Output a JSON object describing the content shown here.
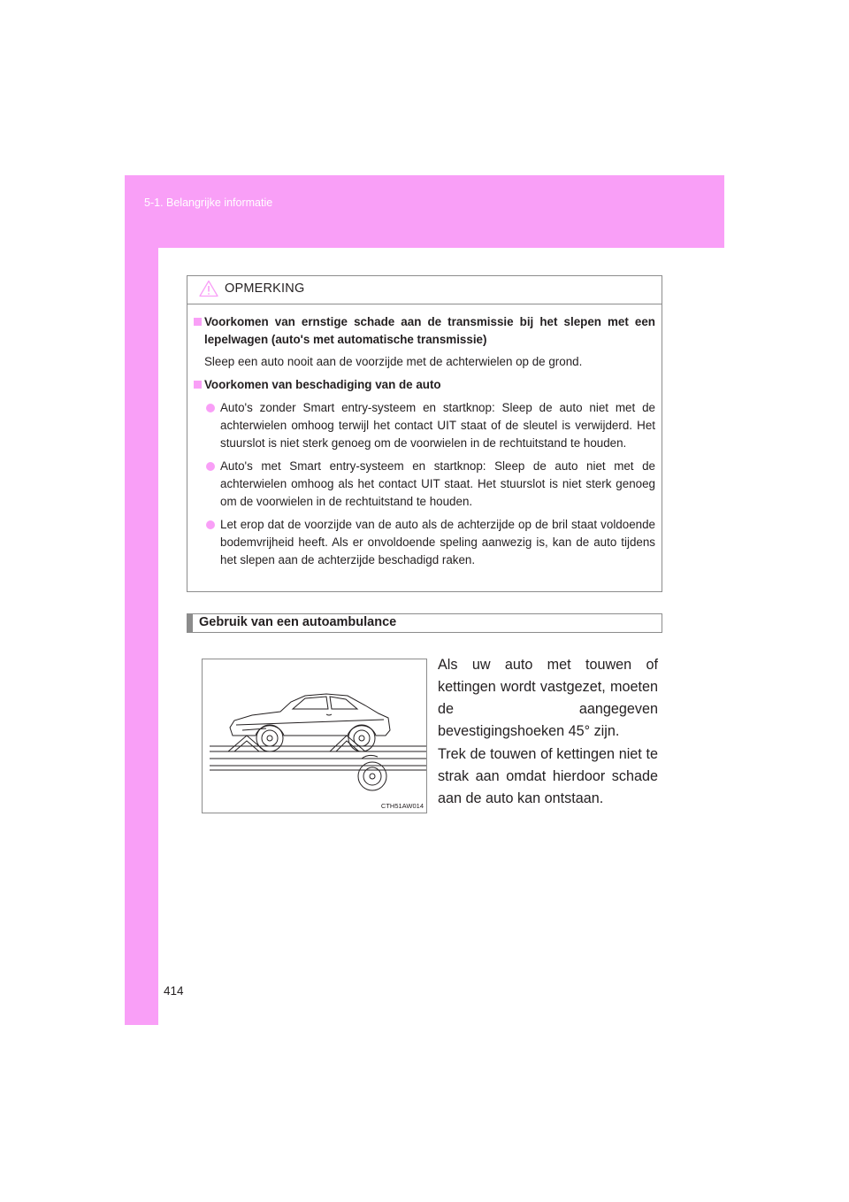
{
  "header": {
    "breadcrumb": "5-1. Belangrijke informatie"
  },
  "notice": {
    "title": "OPMERKING",
    "icon": "warning-triangle-icon",
    "sections": [
      {
        "heading": "Voorkomen van ernstige schade aan de transmissie bij het slepen met een lepelwagen (auto's met automatische transmissie)",
        "text": "Sleep een auto nooit aan de voorzijde met de achterwielen op de grond."
      },
      {
        "heading": "Voorkomen van beschadiging van de auto",
        "bullets": [
          "Auto's zonder Smart entry-systeem en startknop: Sleep de auto niet met de achterwielen omhoog terwijl het contact UIT staat of de sleutel is verwijderd. Het stuurslot is niet sterk genoeg om de voorwielen in de rechtuitstand te houden.",
          "Auto's met Smart entry-systeem en startknop: Sleep de auto niet met de achterwielen omhoog als het contact UIT staat. Het stuurslot is niet sterk genoeg om de voorwielen in de rechtuitstand te houden.",
          "Let erop dat de voorzijde van de auto als de achterzijde op de bril staat voldoende bodemvrijheid heeft. Als er onvoldoende speling aanwezig is, kan de auto tijdens het slepen aan de achterzijde beschadigd raken."
        ]
      }
    ]
  },
  "section": {
    "title": "Gebruik van een autoambulance",
    "figure_code": "CTH51AW014",
    "paragraphs": [
      "Als uw auto met touwen of kettingen wordt vastgezet, moeten de aangegeven bevestigingshoeken 45° zijn.",
      "Trek de touwen of kettingen niet te strak aan omdat hierdoor schade aan de auto kan ontstaan."
    ]
  },
  "page_number": "414",
  "colors": {
    "accent": "#f99ff7",
    "border": "#8c8c8c",
    "text": "#231f20"
  }
}
